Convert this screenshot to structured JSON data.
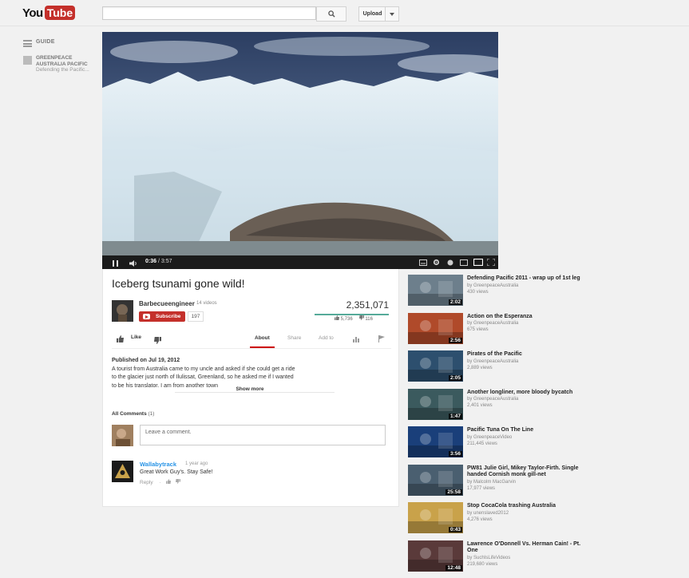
{
  "header": {
    "logo_you": "You",
    "logo_tube": "Tube",
    "search_placeholder": "",
    "upload_label": "Upload"
  },
  "guide": {
    "label": "GUIDE",
    "channel_line1": "GREENPEACE",
    "channel_line2": "AUSTRALIA PACIFIC",
    "channel_sub": "Defending the Pacific..."
  },
  "player": {
    "current_time": "0:36",
    "duration": "/ 3:57",
    "progress_fraction": 0.15
  },
  "video": {
    "title": "Iceberg tsunami gone wild!",
    "channel": "Barbecueengineer",
    "videos_count": "14 videos",
    "subscribe_label": "Subscribe",
    "subscriber_count": "197",
    "views": "2,351,071",
    "likes": "5,736",
    "dislikes": "116",
    "like_label": "Like"
  },
  "tabs": {
    "about": "About",
    "share": "Share",
    "add_to": "Add to"
  },
  "description": {
    "published": "Published on Jul 19, 2012",
    "text": "A tourist from Australia came to my uncle and asked if she could get a ride to the glacier just north of Ilulissat, Greenland, so he asked me if I wanted to be his translator. I am from another town",
    "show_more": "Show more"
  },
  "comments": {
    "title": "All Comments",
    "count": "(1)",
    "placeholder": "Leave a comment.",
    "items": [
      {
        "author": "Wallabytrack",
        "time": "1 year ago",
        "text": "Great Work Guy's. Stay Safe!",
        "reply": "Reply"
      }
    ]
  },
  "related": [
    {
      "title": "Defending Pacific 2011 - wrap up of 1st leg",
      "by": "by GreenpeaceAustralia",
      "views": "430 views",
      "duration": "2:02",
      "thumb_color": "#6d7f8c"
    },
    {
      "title": "Action on the Esperanza",
      "by": "by GreenpeaceAustralia",
      "views": "675 views",
      "duration": "2:56",
      "thumb_color": "#b04a2a"
    },
    {
      "title": "Pirates of the Pacific",
      "by": "by GreenpeaceAustralia",
      "views": "2,889 views",
      "duration": "2:05",
      "thumb_color": "#2d4f6e"
    },
    {
      "title": "Another longliner, more bloody bycatch",
      "by": "by GreenpeaceAustralia",
      "views": "2,401 views",
      "duration": "1:47",
      "thumb_color": "#3b5a5e"
    },
    {
      "title": "Pacific Tuna On The Line",
      "by": "by GreenpeaceVideo",
      "views": "211,445 views",
      "duration": "3:56",
      "thumb_color": "#1a3f7a"
    },
    {
      "title": "PW81 Julie Girl, Mikey Taylor-Firth. Single handed Cornish monk gill-net",
      "by": "by Malcolm MacGarvin",
      "views": "17,977 views",
      "duration": "25:58",
      "thumb_color": "#4a5f70"
    },
    {
      "title": "Stop CocaCola trashing Australia",
      "by": "by unenslaved2012",
      "views": "4,276 views",
      "duration": "0:43",
      "thumb_color": "#c9a24a"
    },
    {
      "title": "Lawrence O'Donnell Vs. Herman Cain! - Pt. One",
      "by": "by SuchIsLifeVideos",
      "views": "219,680 views",
      "duration": "12:48",
      "thumb_color": "#5a3a3a"
    }
  ]
}
